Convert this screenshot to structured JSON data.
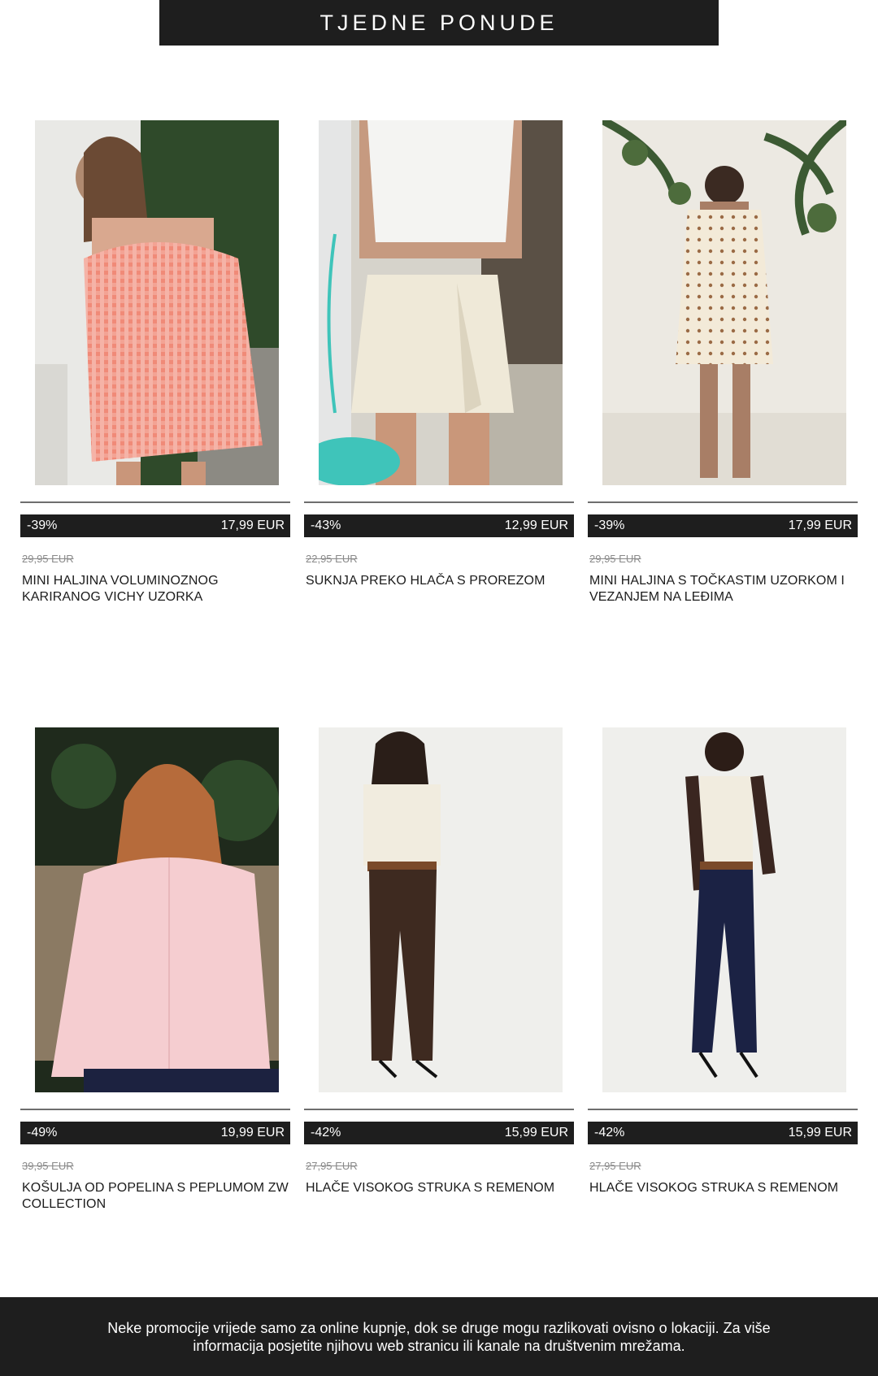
{
  "header": {
    "title": "TJEDNE PONUDE"
  },
  "products": [
    {
      "discount": "-39%",
      "price": "17,99 EUR",
      "old_price": "29,95 EUR",
      "title": "MINI HALJINA VOLUMINOZNOG KARIRANOG VICHY UZORKA",
      "image": "gingham-dress-photo"
    },
    {
      "discount": "-43%",
      "price": "12,99 EUR",
      "old_price": "22,95 EUR",
      "title": "SUKNJA PREKO HLAČA S PROREZOM",
      "image": "skort-photo"
    },
    {
      "discount": "-39%",
      "price": "17,99 EUR",
      "old_price": "29,95 EUR",
      "title": "MINI HALJINA S TOČKASTIM UZORKOM I VEZANJEM NA LEĐIMA",
      "image": "polka-dot-dress-photo"
    },
    {
      "discount": "-49%",
      "price": "19,99 EUR",
      "old_price": "39,95 EUR",
      "title": "KOŠULJA OD POPELINA S PEPLUMOM ZW COLLECTION",
      "image": "pink-shirt-photo"
    },
    {
      "discount": "-42%",
      "price": "15,99 EUR",
      "old_price": "27,95 EUR",
      "title": "HLAČE VISOKOG STRUKA S REMENOM",
      "image": "brown-trousers-photo"
    },
    {
      "discount": "-42%",
      "price": "15,99 EUR",
      "old_price": "27,95 EUR",
      "title": "HLAČE VISOKOG STRUKA S REMENOM",
      "image": "navy-trousers-photo"
    }
  ],
  "footer": {
    "text": "Neke promocije vrijede samo za online kupnje, dok se druge mogu razlikovati ovisno o lokaciji. Za više informacija posjetite njihovu web stranicu ili kanale na društvenim mrežama."
  },
  "colors": {
    "bar": "#1e1e1e",
    "text": "#1c1c1c",
    "muted": "#8a8a8a"
  }
}
